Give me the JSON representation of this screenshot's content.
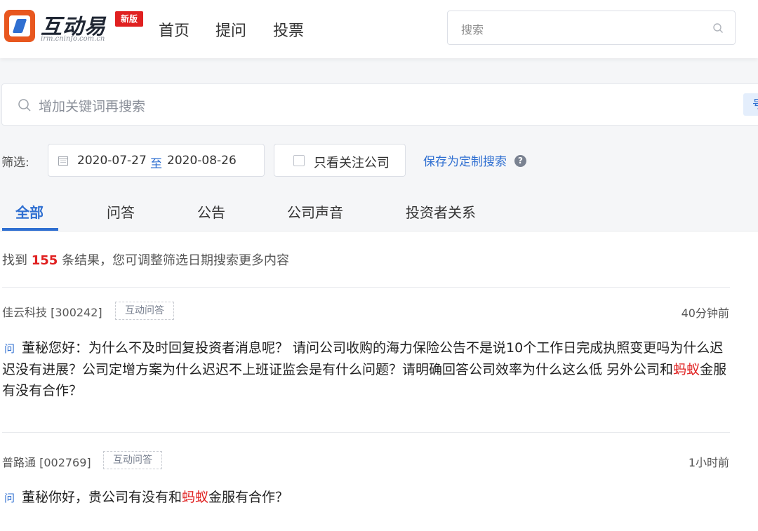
{
  "header": {
    "logo_title": "互动易",
    "logo_sub": "irm.cninfo.com.cn",
    "badge": "新版",
    "nav": [
      "首页",
      "提问",
      "投票"
    ],
    "search_placeholder": "搜索"
  },
  "keyword_search": {
    "placeholder": "增加关键词再搜索",
    "right_button": "号"
  },
  "filter": {
    "label": "筛选:",
    "date_from": "2020-07-27",
    "date_sep": "至",
    "date_to": "2020-08-26",
    "follow_only_label": "只看关注公司",
    "follow_only_checked": false,
    "save_label": "保存为定制搜索",
    "help": "?"
  },
  "tabs": [
    {
      "label": "全部",
      "active": true
    },
    {
      "label": "问答",
      "active": false
    },
    {
      "label": "公告",
      "active": false
    },
    {
      "label": "公司声音",
      "active": false
    },
    {
      "label": "投资者关系",
      "active": false
    }
  ],
  "results": {
    "prefix": "找到",
    "count": "155",
    "suffix": "条结果，您可调整筛选日期搜索更多内容",
    "items": [
      {
        "company": "佳云科技 [300242]",
        "tag": "互动问答",
        "time": "40分钟前",
        "q_mark": "问",
        "q_before": "董秘您好：为什么不及时回复投资者消息呢？ 请问公司收购的海力保险公告不是说10个工作日完成执照变更吗为什么迟迟没有进展？公司定增方案为什么迟迟不上班证监会是有什么问题？请明确回答公司效率为什么这么低 另外公司和",
        "q_highlight": "蚂蚁",
        "q_after": "金服有没有合作？"
      },
      {
        "company": "普路通 [002769]",
        "tag": "互动问答",
        "time": "1小时前",
        "q_mark": "问",
        "q_before": "董秘你好，贵公司有没有和",
        "q_highlight": "蚂蚁",
        "q_after": "金服有合作？"
      }
    ]
  },
  "colors": {
    "accent": "#2f6fd1",
    "highlight": "#e02020",
    "logo": "#e8571f"
  }
}
